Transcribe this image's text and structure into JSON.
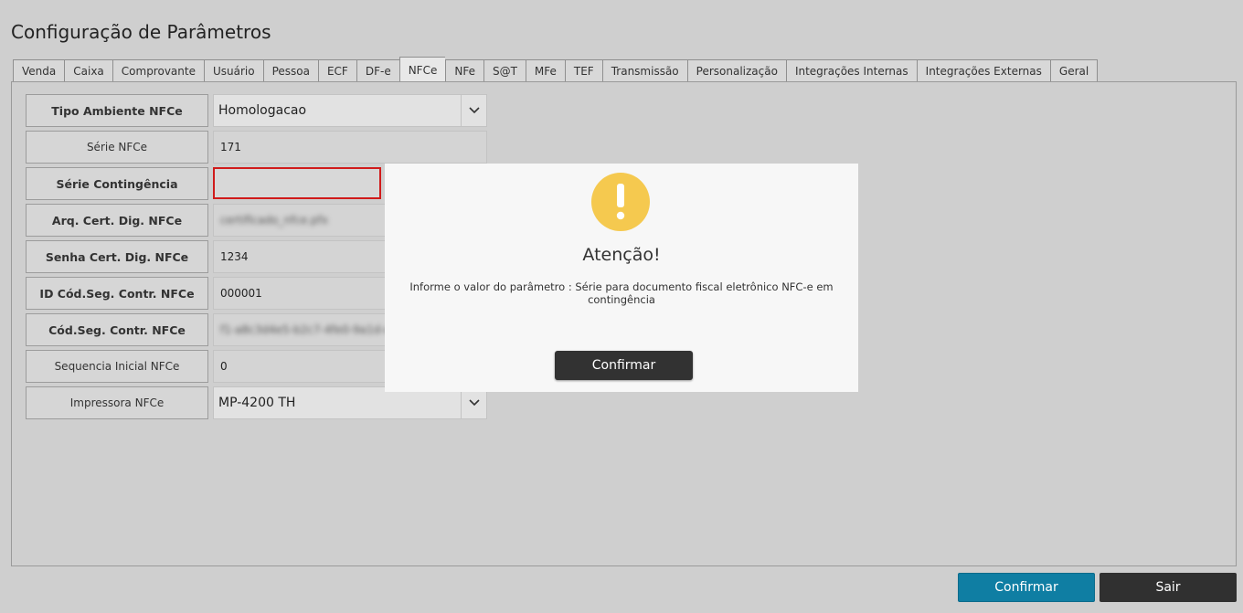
{
  "page": {
    "title": "Configuração de Parâmetros"
  },
  "tabs": [
    {
      "label": "Venda"
    },
    {
      "label": "Caixa"
    },
    {
      "label": "Comprovante"
    },
    {
      "label": "Usuário"
    },
    {
      "label": "Pessoa"
    },
    {
      "label": "ECF"
    },
    {
      "label": "DF-e"
    },
    {
      "label": "NFCe",
      "active": true
    },
    {
      "label": "NFe"
    },
    {
      "label": "S@T"
    },
    {
      "label": "MFe"
    },
    {
      "label": "TEF"
    },
    {
      "label": "Transmissão"
    },
    {
      "label": "Personalização"
    },
    {
      "label": "Integrações Internas"
    },
    {
      "label": "Integrações Externas"
    },
    {
      "label": "Geral"
    }
  ],
  "form": {
    "rows": [
      {
        "label": "Tipo Ambiente NFCe",
        "value": "Homologacao",
        "type": "select",
        "icon": "chevron-down-icon"
      },
      {
        "label": "Série NFCe",
        "value": "171"
      },
      {
        "label": "Série Contingência",
        "value": "",
        "state": "error"
      },
      {
        "label": "Arq. Cert. Dig. NFCe",
        "value": "certificado_nfce.pfx",
        "redacted": true
      },
      {
        "label": "Senha Cert. Dig. NFCe",
        "value": "1234"
      },
      {
        "label": "ID Cód.Seg. Contr. NFCe",
        "value": "000001"
      },
      {
        "label": "Cód.Seg. Contr. NFCe",
        "value": "f1-a8c3d4e5-b2c7-4fe0-9a1d-e3b5f7a9",
        "redacted": true
      },
      {
        "label": "Sequencia Inicial NFCe",
        "value": "0"
      },
      {
        "label": "Impressora NFCe",
        "value": "MP-4200 TH",
        "type": "select",
        "icon": "chevron-down-icon"
      }
    ]
  },
  "modal": {
    "icon": "warning-icon",
    "title": "Atenção!",
    "message": "Informe o valor do parâmetro : Série para documento fiscal eletrônico NFC-e em contingência",
    "confirm_label": "Confirmar"
  },
  "footer": {
    "confirm_label": "Confirmar",
    "exit_label": "Sair"
  },
  "colors": {
    "accent": "#0f7ea3",
    "error": "#d01b1b",
    "warning": "#f5c94f",
    "dark_button": "#303030"
  }
}
